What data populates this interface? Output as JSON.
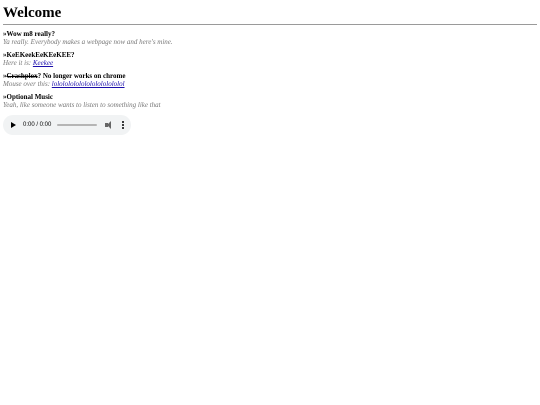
{
  "page": {
    "title": "Welcome"
  },
  "sections": [
    {
      "prefix": "»",
      "title": "Wow m8 really?",
      "desc": "Ya really. Everybody makes a webpage now and here's mine."
    },
    {
      "prefix": "»",
      "title": "KeEKeekEeKEeKEE?",
      "desc_prefix": "Here it is: ",
      "link": "Keekee"
    },
    {
      "prefix": "»",
      "title_strike": "Crashplox",
      "title_rest": "? No longer works on chrome",
      "desc_prefix": "Mouse over this: ",
      "link": "lololololololololololololol"
    },
    {
      "prefix": "»",
      "title": "Optional Music",
      "desc": "Yeah, like someone wants to listen to something like that"
    }
  ],
  "audio_player": {
    "time": "0:00 / 0:00",
    "progress": 0
  }
}
